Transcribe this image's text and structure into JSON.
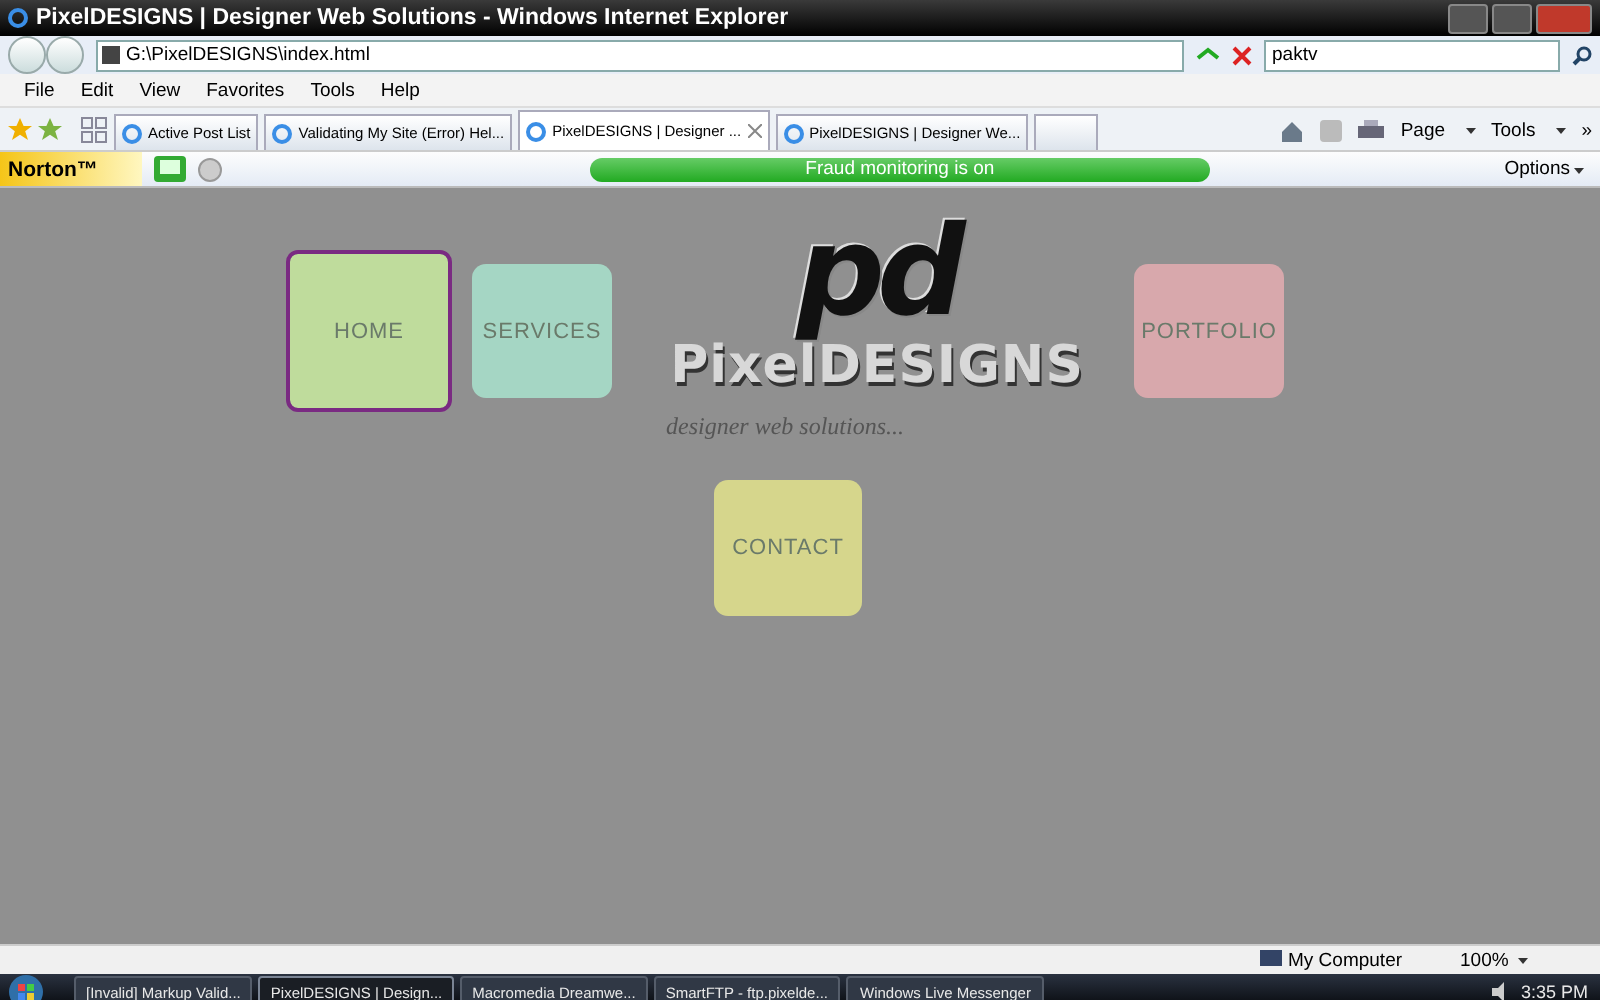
{
  "window": {
    "title": "PixelDESIGNS | Designer Web Solutions - Windows Internet Explorer"
  },
  "address_bar": {
    "url": "G:\\PixelDESIGNS\\index.html"
  },
  "search": {
    "value": "paktv"
  },
  "menu": [
    "File",
    "Edit",
    "View",
    "Favorites",
    "Tools",
    "Help"
  ],
  "tabs": [
    {
      "label": "Active Post List",
      "selected": false
    },
    {
      "label": "Validating My Site (Error) Hel...",
      "selected": false
    },
    {
      "label": "PixelDESIGNS | Designer ...",
      "selected": true
    },
    {
      "label": "PixelDESIGNS | Designer We...",
      "selected": false
    }
  ],
  "command_bar": {
    "page": "Page",
    "tools": "Tools",
    "more": "»"
  },
  "norton": {
    "brand": "Norton™",
    "status": "Fraud monitoring is on",
    "options": "Options"
  },
  "page": {
    "logo_mark": "pd",
    "logo_text": "PixelDESIGNS",
    "tagline": "designer web solutions...",
    "nav": [
      {
        "label": "HOME",
        "color": "#bfdc9c",
        "selected": true
      },
      {
        "label": "SERVICES",
        "color": "#a5d6c4",
        "selected": false
      },
      {
        "label": "PORTFOLIO",
        "color": "#d8a8ac",
        "selected": false
      },
      {
        "label": "CONTACT",
        "color": "#d6d68c",
        "selected": false
      }
    ]
  },
  "status_bar": {
    "zone": "My Computer",
    "zoom": "100%"
  },
  "taskbar": {
    "items": [
      {
        "label": "[Invalid] Markup Valid...",
        "selected": false
      },
      {
        "label": "PixelDESIGNS | Design...",
        "selected": true
      },
      {
        "label": "Macromedia Dreamwe...",
        "selected": false
      },
      {
        "label": "SmartFTP - ftp.pixelde...",
        "selected": false
      },
      {
        "label": "Windows Live Messenger",
        "selected": false
      }
    ],
    "clock": "3:35 PM"
  }
}
